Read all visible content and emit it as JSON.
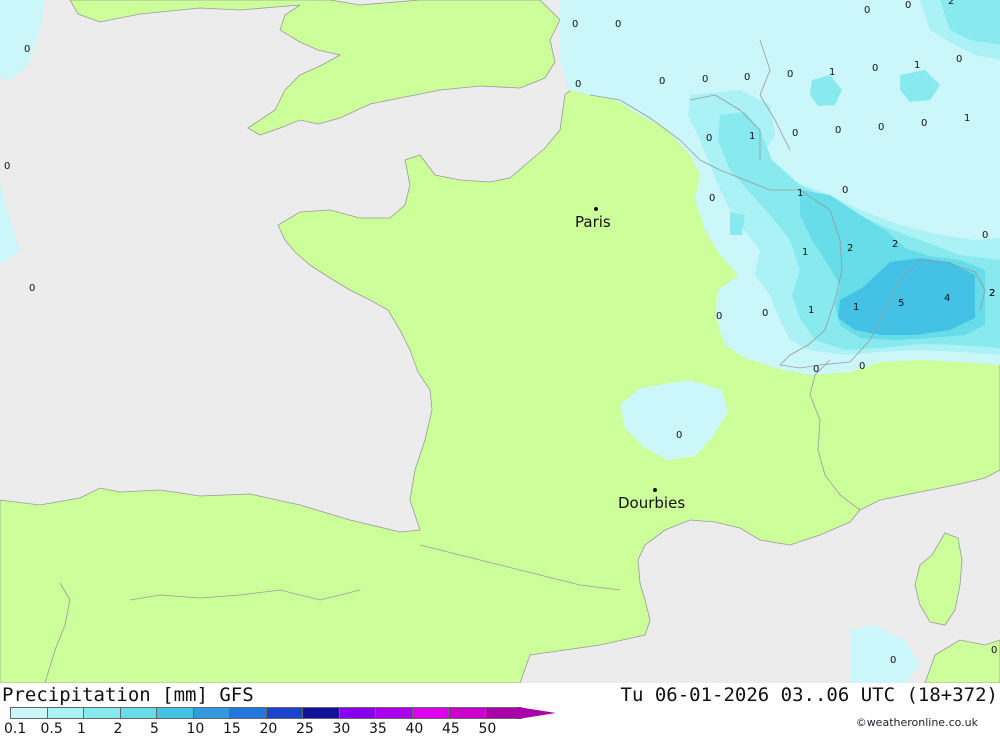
{
  "title": "Precipitation [mm] GFS",
  "valid_time": "Tu 06-01-2026 03..06 UTC (18+372)",
  "credit": "©weatheronline.co.uk",
  "colors": {
    "sea": "#ececec",
    "land": "#ccff99",
    "border": "#999999"
  },
  "legend": {
    "ticks": [
      "0.1",
      "0.5",
      "1",
      "2",
      "5",
      "10",
      "15",
      "20",
      "25",
      "30",
      "35",
      "40",
      "45",
      "50"
    ],
    "colors": [
      "#ccf7fa",
      "#aaf2f5",
      "#88eaee",
      "#66dde8",
      "#44c2e6",
      "#3399e0",
      "#2277dd",
      "#1a44cc",
      "#111199",
      "#8800ee",
      "#aa00ee",
      "#dd00ee",
      "#cc00cc",
      "#aa00aa"
    ]
  },
  "cities": [
    {
      "name": "Paris"
    },
    {
      "name": "Dourbies"
    }
  ],
  "precip_values": [
    "0",
    "0",
    "0",
    "0",
    "2",
    "0",
    "0",
    "0",
    "0",
    "0",
    "0",
    "0",
    "0",
    "1",
    "0",
    "1",
    "0",
    "0",
    "1",
    "0",
    "0",
    "0",
    "1",
    "0",
    "0",
    "0",
    "1",
    "0",
    "1",
    "2",
    "2",
    "0",
    "0",
    "1",
    "1",
    "2",
    "5",
    "4",
    "2",
    "0",
    "0",
    "0",
    "0",
    "0",
    "0"
  ]
}
